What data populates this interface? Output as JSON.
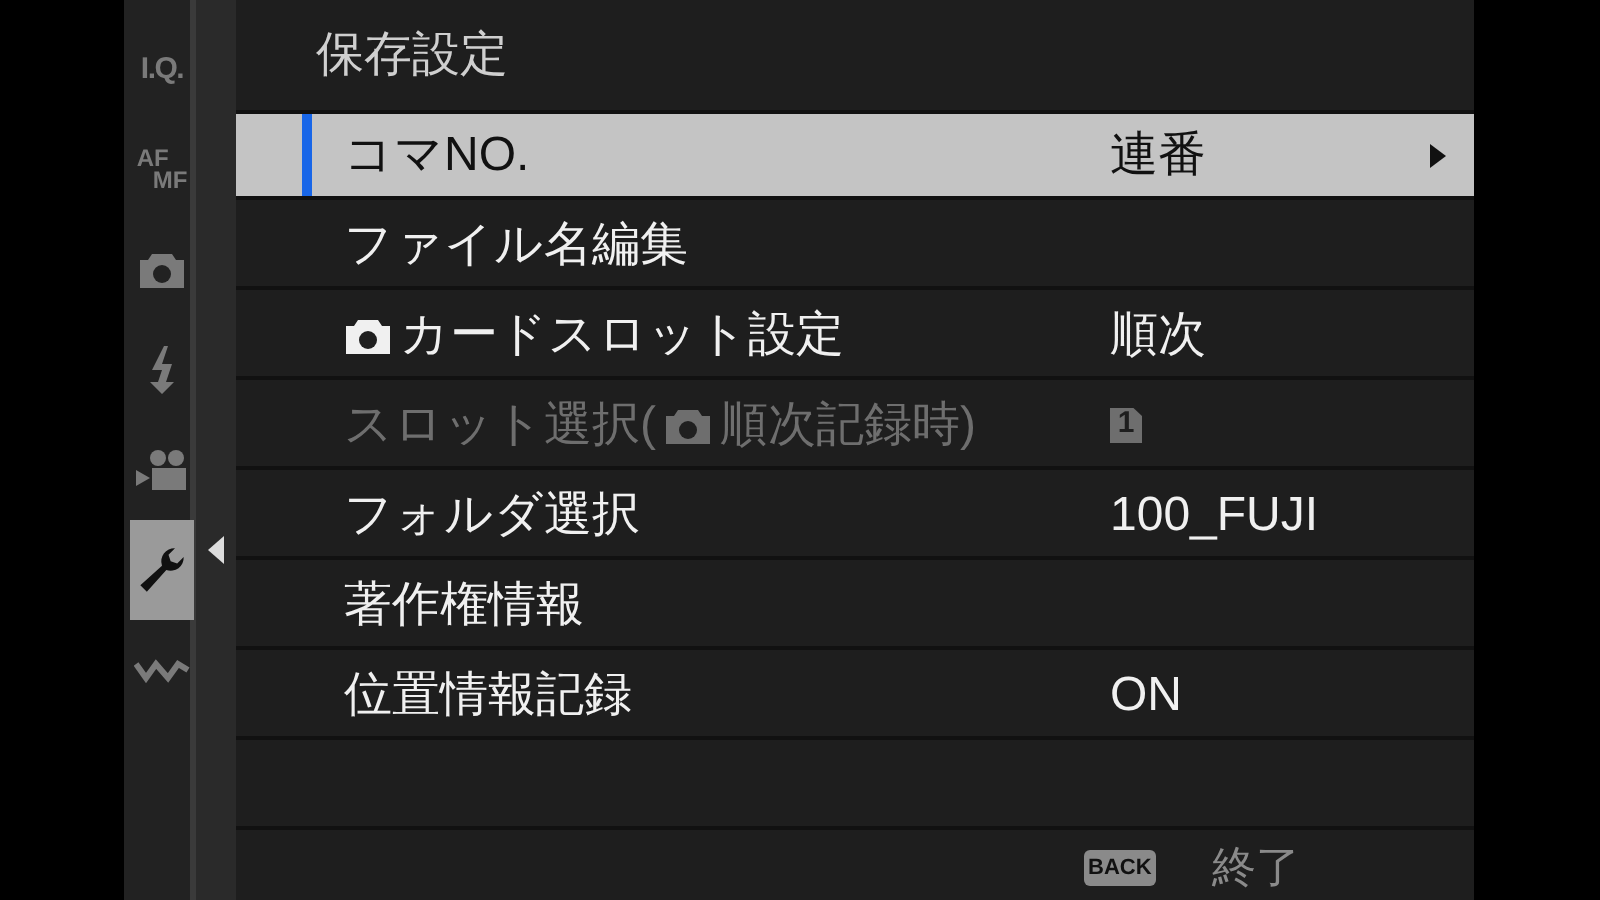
{
  "sidebar": {
    "items": [
      {
        "kind": "text",
        "label": "I.Q.",
        "selected": false
      },
      {
        "kind": "afmf",
        "label": "AF",
        "label2": "MF",
        "selected": false
      },
      {
        "kind": "camera",
        "selected": false
      },
      {
        "kind": "flash",
        "selected": false
      },
      {
        "kind": "movie",
        "selected": false
      },
      {
        "kind": "wrench",
        "selected": true
      },
      {
        "kind": "connection",
        "selected": false
      }
    ]
  },
  "menu": {
    "title": "保存設定",
    "rows": [
      {
        "label": [
          {
            "kind": "text",
            "text": "コマNO."
          }
        ],
        "value": {
          "kind": "text",
          "text": "連番"
        },
        "selected": true,
        "disabled": false,
        "submenu": true
      },
      {
        "label": [
          {
            "kind": "text",
            "text": "ファイル名編集"
          }
        ],
        "selected": false,
        "disabled": false,
        "submenu": false
      },
      {
        "label": [
          {
            "kind": "camera"
          },
          {
            "kind": "text",
            "text": "カードスロット設定"
          }
        ],
        "value": {
          "kind": "text",
          "text": "順次"
        },
        "selected": false,
        "disabled": false,
        "submenu": false
      },
      {
        "label": [
          {
            "kind": "text",
            "text": "スロット選択("
          },
          {
            "kind": "camera"
          },
          {
            "kind": "text",
            "text": "順次記録時)"
          }
        ],
        "value": {
          "kind": "slot",
          "text": "1"
        },
        "selected": false,
        "disabled": true,
        "submenu": false
      },
      {
        "label": [
          {
            "kind": "text",
            "text": "フォルダ選択"
          }
        ],
        "value": {
          "kind": "text",
          "text": "100_FUJI"
        },
        "selected": false,
        "disabled": false,
        "submenu": false
      },
      {
        "label": [
          {
            "kind": "text",
            "text": "著作権情報"
          }
        ],
        "selected": false,
        "disabled": false,
        "submenu": false
      },
      {
        "label": [
          {
            "kind": "text",
            "text": "位置情報記録"
          }
        ],
        "value": {
          "kind": "text",
          "text": "ON"
        },
        "selected": false,
        "disabled": false,
        "submenu": false
      }
    ]
  },
  "footer": {
    "key": "BACK",
    "action": "終了"
  }
}
